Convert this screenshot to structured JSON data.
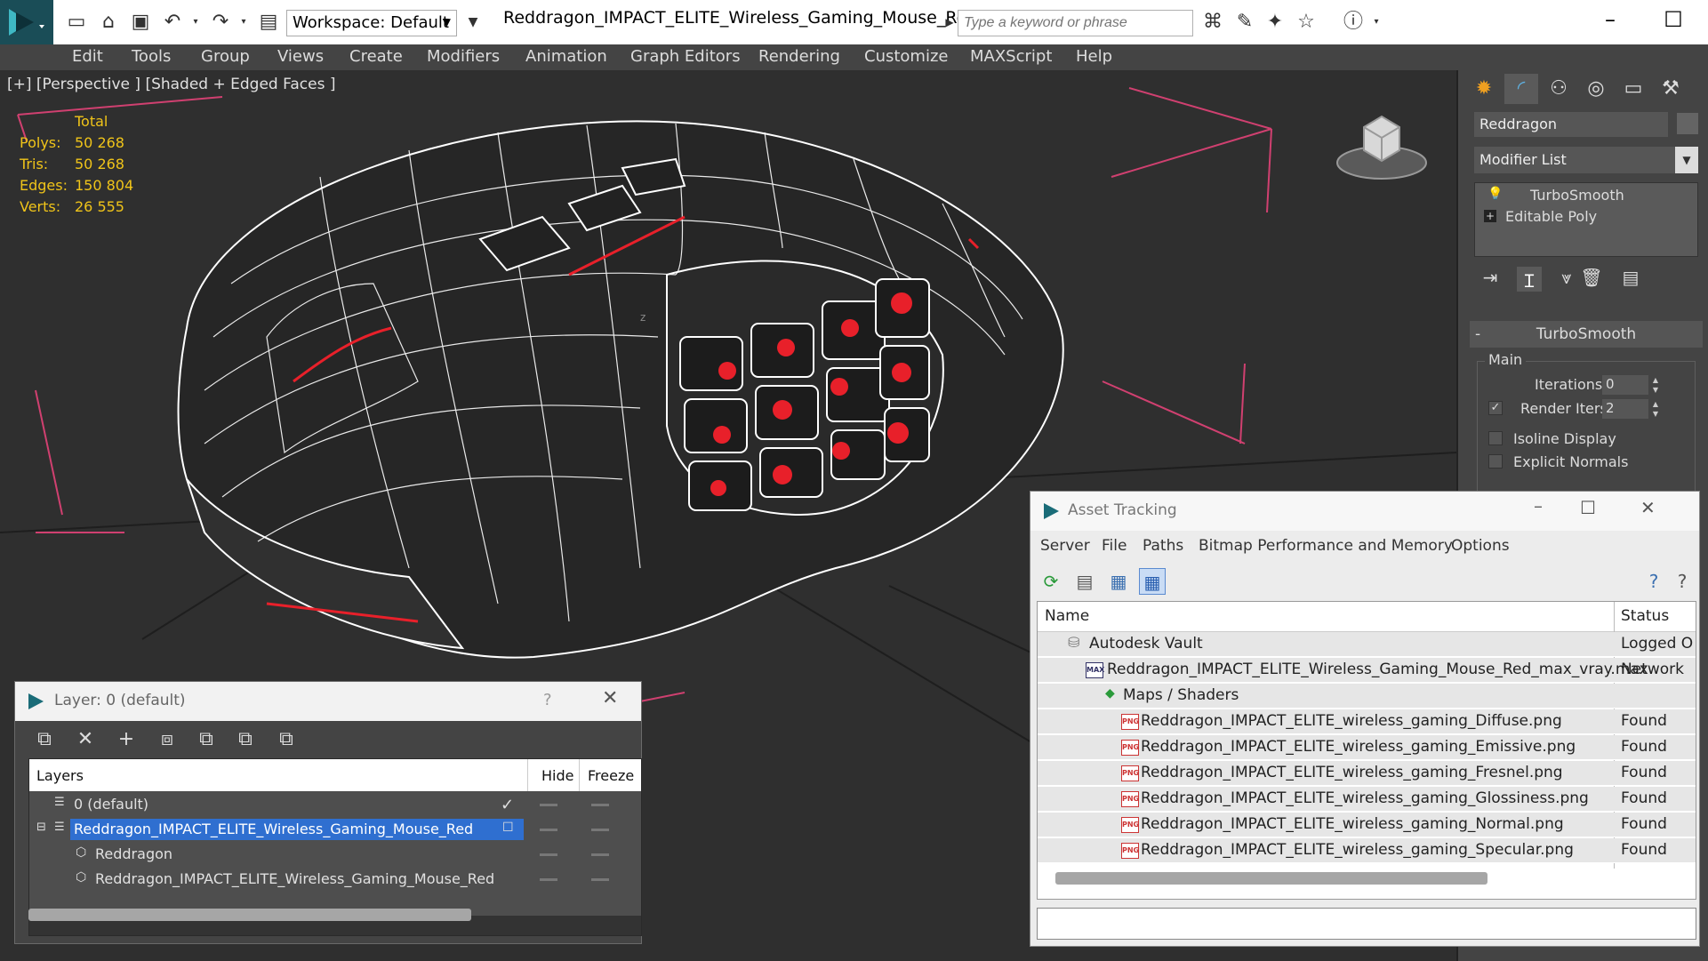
{
  "titlebar": {
    "workspace": "Workspace: Default",
    "title": "Reddragon_IMPACT_ELITE_Wireless_Gaming_Mouse_Red_m...",
    "search_placeholder": "Type a keyword or phrase"
  },
  "menu": [
    "Edit",
    "Tools",
    "Group",
    "Views",
    "Create",
    "Modifiers",
    "Animation",
    "Graph Editors",
    "Rendering",
    "Customize",
    "MAXScript",
    "Help"
  ],
  "viewport": {
    "label": "[+] [Perspective ] [Shaded + Edged Faces ]",
    "stats": {
      "total_label": "Total",
      "rows": [
        {
          "key": "Polys:",
          "value": "50 268"
        },
        {
          "key": "Tris:",
          "value": "50 268"
        },
        {
          "key": "Edges:",
          "value": "150 804"
        },
        {
          "key": "Verts:",
          "value": "26 555"
        }
      ]
    }
  },
  "command_panel": {
    "object_name": "Reddragon",
    "modifier_list": "Modifier List",
    "stack": [
      "TurboSmooth",
      "Editable Poly"
    ],
    "rollout_title": "TurboSmooth",
    "group_label": "Main",
    "iterations_label": "Iterations:",
    "iterations_value": "0",
    "render_iters_label": "Render Iters:",
    "render_iters_value": "2",
    "isoline_label": "Isoline Display",
    "explicit_normals_label": "Explicit Normals"
  },
  "layer_dialog": {
    "title": "Layer: 0 (default)",
    "help": "?",
    "columns": {
      "layers": "Layers",
      "hide": "Hide",
      "freeze": "Freeze"
    },
    "rows": [
      {
        "label": "0 (default)"
      },
      {
        "label": "Reddragon_IMPACT_ELITE_Wireless_Gaming_Mouse_Red"
      },
      {
        "label": "Reddragon"
      },
      {
        "label": "Reddragon_IMPACT_ELITE_Wireless_Gaming_Mouse_Red"
      }
    ]
  },
  "asset_dialog": {
    "title": "Asset Tracking",
    "menu": [
      "Server",
      "File",
      "Paths",
      "Bitmap Performance and Memory",
      "Options"
    ],
    "columns": {
      "name": "Name",
      "status": "Status"
    },
    "rows": [
      {
        "name": "Autodesk Vault",
        "status": "Logged O"
      },
      {
        "name": "Reddragon_IMPACT_ELITE_Wireless_Gaming_Mouse_Red_max_vray.max",
        "status": "Network"
      },
      {
        "name": "Maps / Shaders",
        "status": ""
      },
      {
        "name": "Reddragon_IMPACT_ELITE_wireless_gaming_Diffuse.png",
        "status": "Found"
      },
      {
        "name": "Reddragon_IMPACT_ELITE_wireless_gaming_Emissive.png",
        "status": "Found"
      },
      {
        "name": "Reddragon_IMPACT_ELITE_wireless_gaming_Fresnel.png",
        "status": "Found"
      },
      {
        "name": "Reddragon_IMPACT_ELITE_wireless_gaming_Glossiness.png",
        "status": "Found"
      },
      {
        "name": "Reddragon_IMPACT_ELITE_wireless_gaming_Normal.png",
        "status": "Found"
      },
      {
        "name": "Reddragon_IMPACT_ELITE_wireless_gaming_Specular.png",
        "status": "Found"
      }
    ],
    "png_badge": "PNG",
    "max_badge": "MAX"
  },
  "colors": {
    "stats_yellow": "#f0c419",
    "selection_blue": "#2f6fd0",
    "accent_red": "#e8202a"
  }
}
